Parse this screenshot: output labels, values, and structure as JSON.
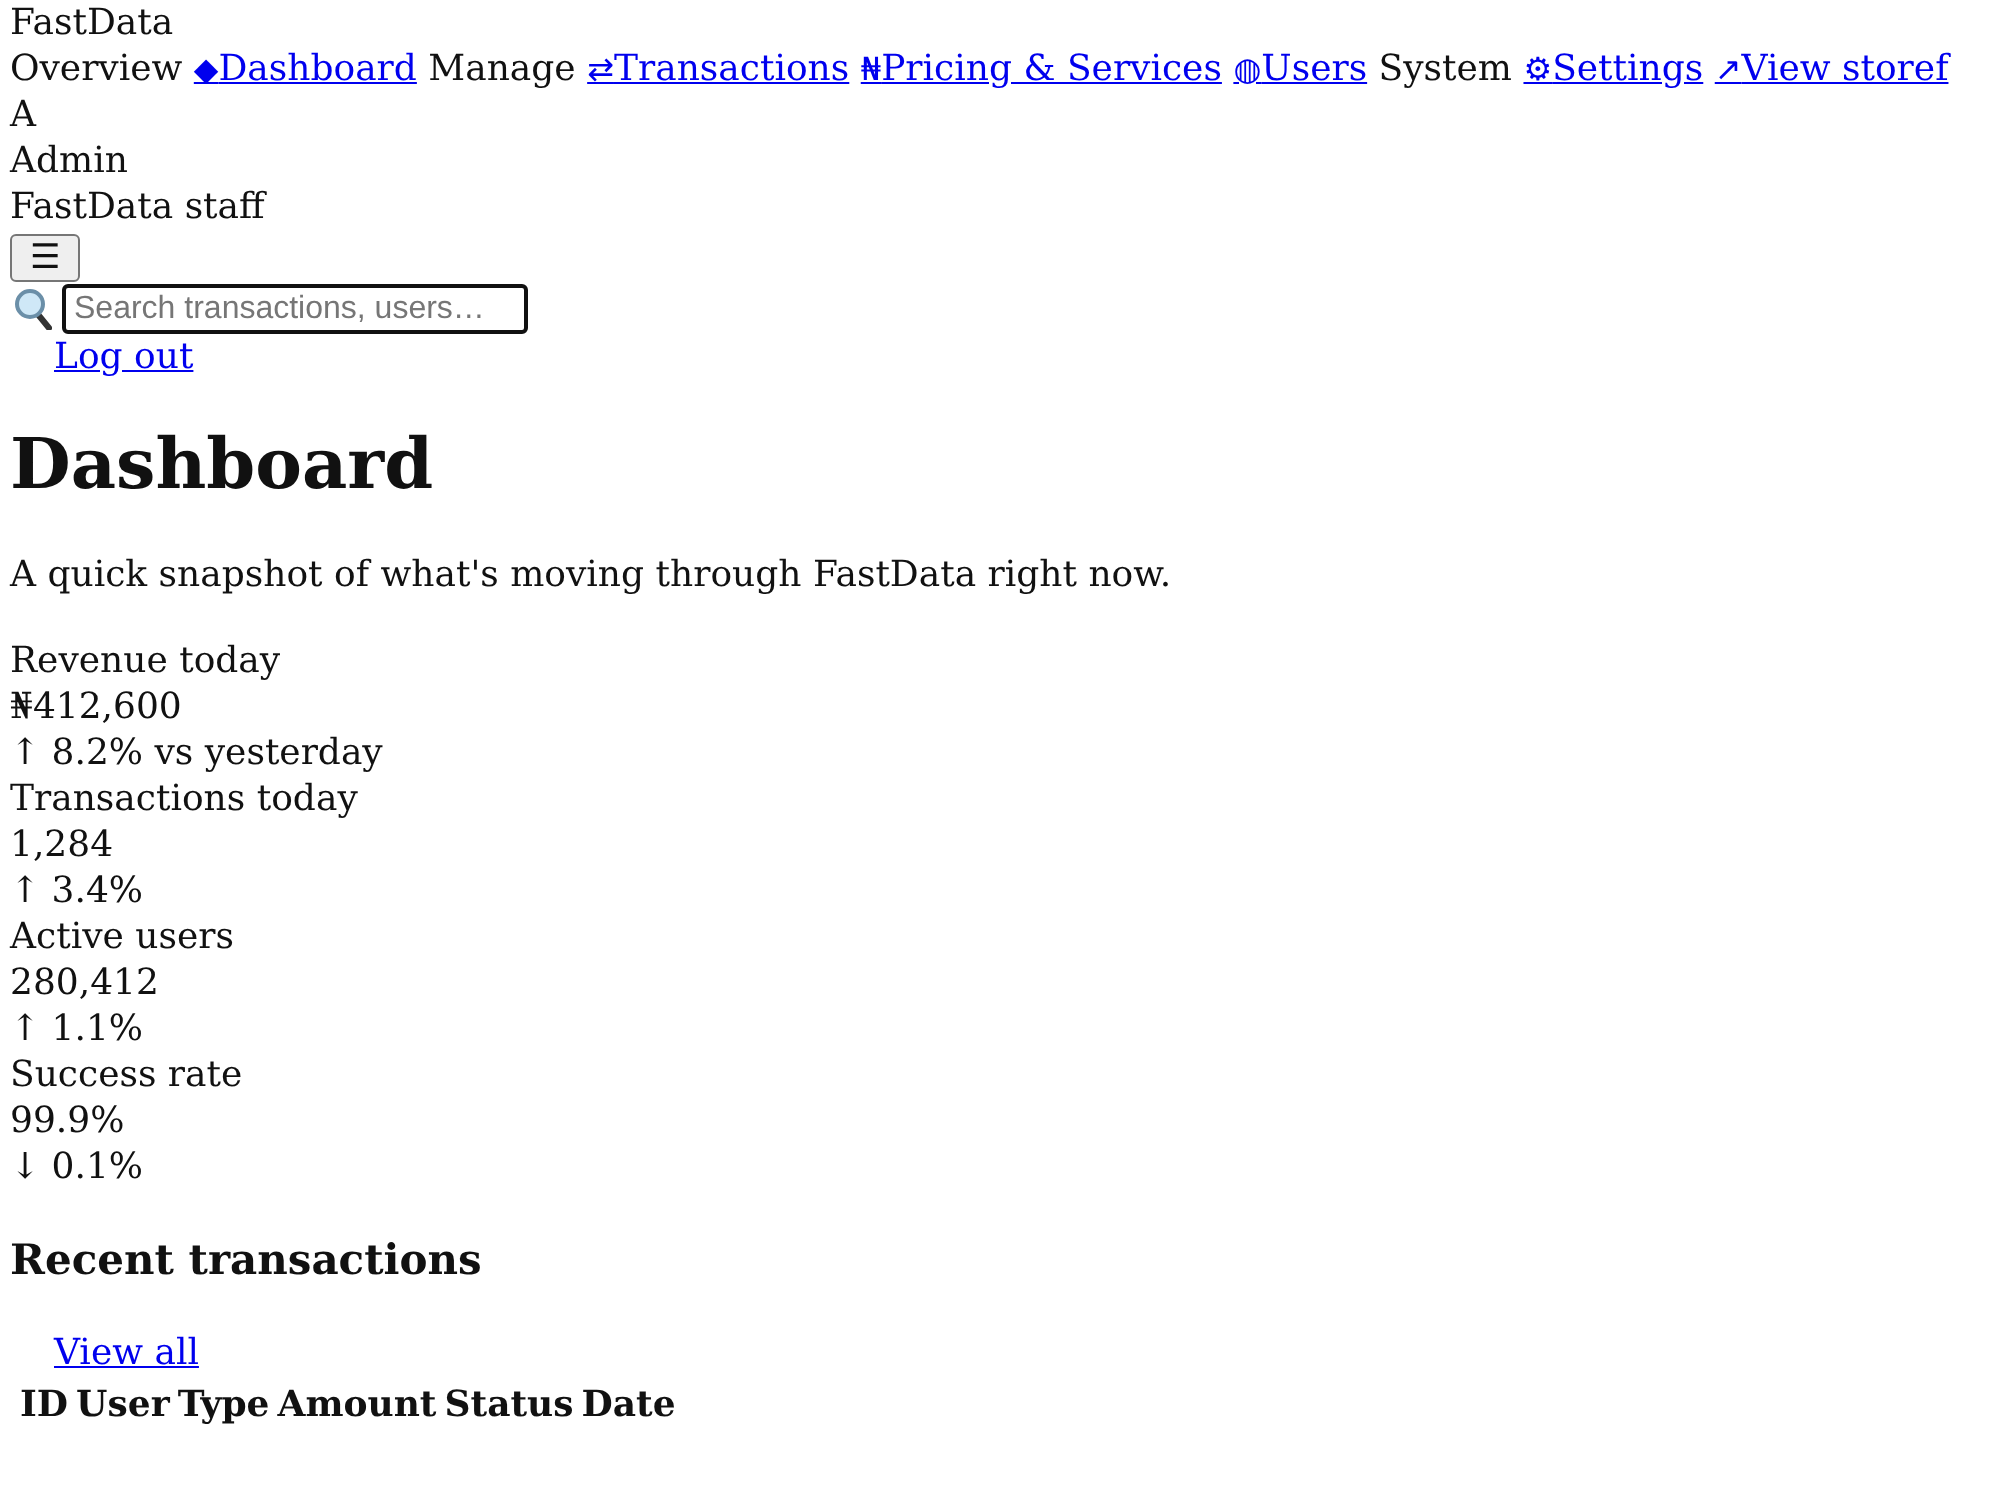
{
  "brand": {
    "name": "FastData"
  },
  "nav": {
    "groups": [
      {
        "heading": "Overview",
        "links": [
          {
            "icon": "◆",
            "label": "Dashboard"
          }
        ]
      },
      {
        "heading": "Manage",
        "links": [
          {
            "icon": "⇄",
            "label": "Transactions"
          },
          {
            "icon": "₦",
            "label": "Pricing & Services"
          },
          {
            "icon": "◍",
            "label": "Users"
          }
        ]
      },
      {
        "heading": "System",
        "links": [
          {
            "icon": "⚙",
            "label": "Settings"
          },
          {
            "icon": "↗",
            "label": "View storef"
          }
        ]
      }
    ]
  },
  "user": {
    "initial": "A",
    "name": "Admin",
    "role": "FastData staff"
  },
  "menu_button": {
    "label": "☰"
  },
  "search": {
    "placeholder": "Search transactions, users…"
  },
  "logout": {
    "label": "Log out"
  },
  "page": {
    "title": "Dashboard",
    "subtitle": "A quick snapshot of what's moving through FastData right now."
  },
  "stats": [
    {
      "label": "Revenue today",
      "value": "₦412,600",
      "change": "↑ 8.2% vs yesterday"
    },
    {
      "label": "Transactions today",
      "value": "1,284",
      "change": "↑ 3.4%"
    },
    {
      "label": "Active users",
      "value": "280,412",
      "change": "↑ 1.1%"
    },
    {
      "label": "Success rate",
      "value": "99.9%",
      "change": "↓ 0.1%"
    }
  ],
  "recent": {
    "title": "Recent transactions",
    "link": "View all",
    "table": {
      "columns": [
        "ID",
        "User",
        "Type",
        "Amount",
        "Status",
        "Date"
      ]
    }
  }
}
